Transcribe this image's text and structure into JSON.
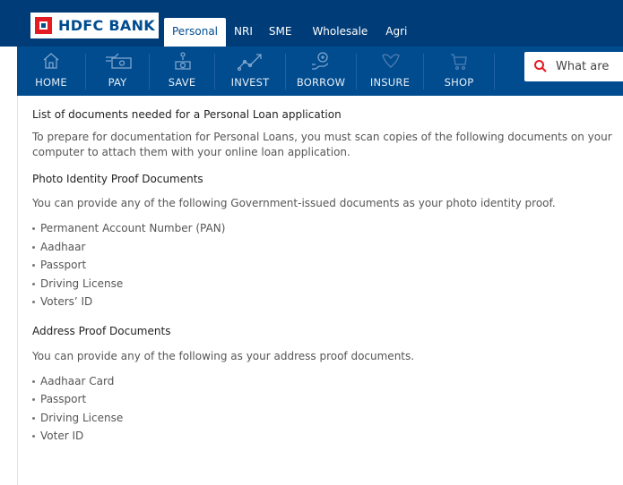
{
  "brand": {
    "name": "HDFC BANK",
    "logo_icon": "hdfc-logo-icon",
    "colors": {
      "primary": "#004c8f",
      "dark": "#003c78",
      "logo_red": "#e41b23",
      "search_icon": "#e41b23"
    }
  },
  "segments": [
    {
      "label": "Personal",
      "active": true
    },
    {
      "label": "NRI",
      "active": false
    },
    {
      "label": "SME",
      "active": false
    },
    {
      "label": "Wholesale",
      "active": false
    },
    {
      "label": "Agri",
      "active": false
    }
  ],
  "nav": [
    {
      "label": "HOME",
      "icon": "home-icon"
    },
    {
      "label": "PAY",
      "icon": "pay-icon"
    },
    {
      "label": "SAVE",
      "icon": "save-icon"
    },
    {
      "label": "INVEST",
      "icon": "invest-icon"
    },
    {
      "label": "BORROW",
      "icon": "borrow-icon"
    },
    {
      "label": "INSURE",
      "icon": "insure-icon"
    },
    {
      "label": "SHOP",
      "icon": "shop-icon"
    }
  ],
  "search": {
    "placeholder": "What are",
    "icon": "search-icon"
  },
  "content": {
    "heading": "List of documents needed for a Personal Loan application",
    "intro": "To prepare for documentation for Personal Loans, you must scan copies of the following documents on your computer to attach them with your online loan application.",
    "identity": {
      "heading": "Photo Identity Proof Documents",
      "text": "You can provide any of the following Government-issued documents as your photo identity proof.",
      "items": [
        "Permanent Account Number (PAN)",
        "Aadhaar",
        "Passport",
        "Driving License",
        "Voters’ ID"
      ]
    },
    "address": {
      "heading": "Address Proof Documents",
      "text": "You can provide any of the following as your address proof documents.",
      "items": [
        "Aadhaar Card",
        "Passport",
        "Driving License",
        "Voter ID"
      ]
    }
  }
}
